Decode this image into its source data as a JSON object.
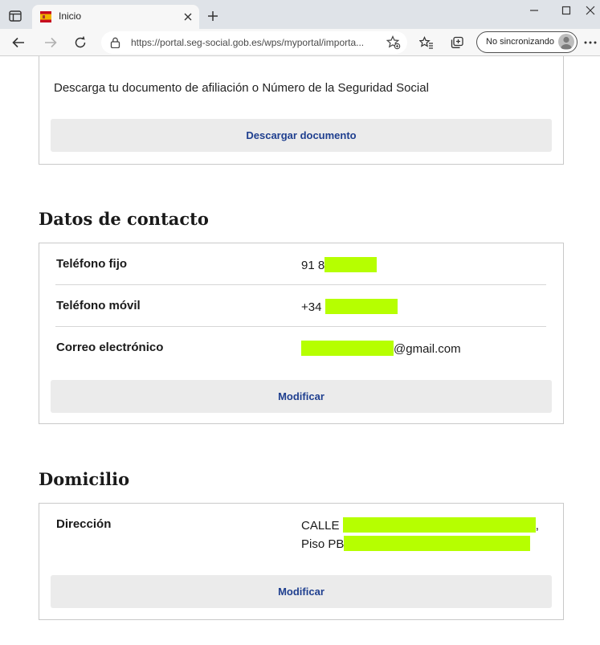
{
  "browser": {
    "tab_title": "Inicio",
    "url": "https://portal.seg-social.gob.es/wps/myportal/importa...",
    "sync_label": "No sincronizando"
  },
  "affiliation": {
    "description": "Descarga tu documento de afiliación o Número de la Seguridad Social",
    "download_button": "Descargar documento"
  },
  "contact": {
    "heading": "Datos de contacto",
    "rows": [
      {
        "label": "Teléfono fijo",
        "value_prefix": "91 8",
        "value_suffix": ""
      },
      {
        "label": "Teléfono móvil",
        "value_prefix": "+34",
        "value_suffix": ""
      },
      {
        "label": "Correo electrónico",
        "value_prefix": "",
        "value_suffix": "@gmail.com"
      }
    ],
    "modify_button": "Modificar"
  },
  "address": {
    "heading": "Domicilio",
    "label": "Dirección",
    "line1_prefix": "CALLE",
    "line1_suffix": ",",
    "line2_prefix": "Piso PB",
    "modify_button": "Modificar"
  },
  "colors": {
    "accent_text": "#1f3f8f",
    "redaction": "#b6ff00",
    "button_bg": "#ebebeb"
  },
  "icons": [
    "tab-actions-icon",
    "spain-flag-icon",
    "close-icon",
    "plus-icon",
    "minimize-icon",
    "maximize-icon",
    "back-arrow-icon",
    "forward-arrow-icon",
    "refresh-icon",
    "lock-icon",
    "add-favorite-icon",
    "favorites-icon",
    "collections-icon",
    "profile-avatar-icon",
    "more-icon"
  ]
}
